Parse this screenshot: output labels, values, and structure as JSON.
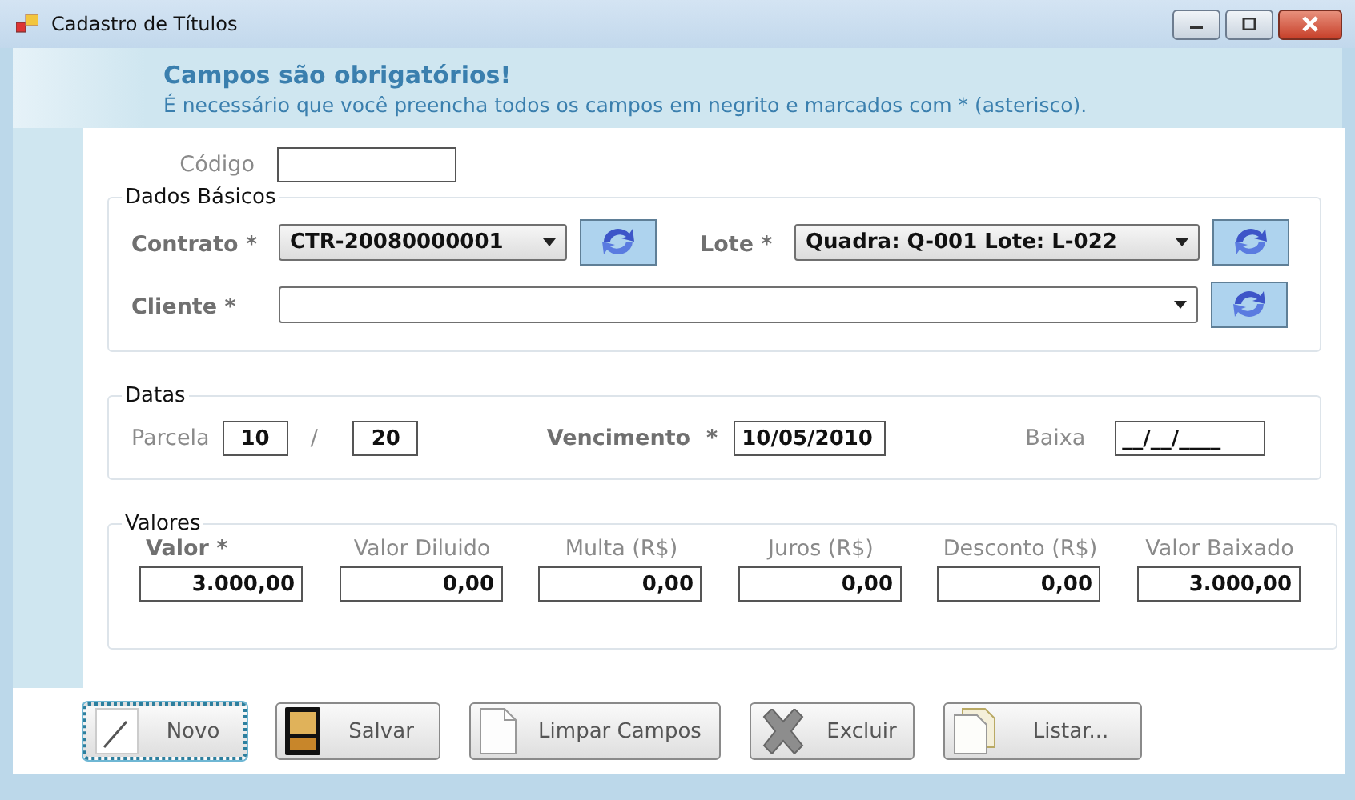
{
  "window": {
    "title": "Cadastro de Títulos"
  },
  "notice": {
    "title": "Campos são obrigatórios!",
    "text": "É necessário que você preencha todos os campos em negrito e marcados com * (asterisco)."
  },
  "codigo": {
    "label": "Código"
  },
  "dados_basicos": {
    "legend": "Dados Básicos",
    "contrato": {
      "label": "Contrato *",
      "value": "CTR-20080000001",
      "required": true
    },
    "lote": {
      "label": "Lote *",
      "value": "Quadra: Q-001 Lote: L-022",
      "required": true
    },
    "cliente": {
      "label": "Cliente *",
      "required": true
    }
  },
  "datas": {
    "legend": "Datas",
    "parcela": {
      "label": "Parcela",
      "value": "10",
      "separator": "/",
      "total": "20",
      "required": false
    },
    "vencimento": {
      "label": "Vencimento",
      "mark": "*",
      "value": "10/05/2010",
      "required": true
    },
    "baixa": {
      "label": "Baixa",
      "value": "__/__/____",
      "required": false
    }
  },
  "valores": {
    "legend": "Valores",
    "fields": [
      {
        "label": "Valor *",
        "value": "3.000,00",
        "required": true
      },
      {
        "label": "Valor Diluido",
        "value": "0,00",
        "required": false
      },
      {
        "label": "Multa (R$)",
        "value": "0,00",
        "required": false
      },
      {
        "label": "Juros (R$)",
        "value": "0,00",
        "required": false
      },
      {
        "label": "Desconto (R$)",
        "value": "0,00",
        "required": false
      },
      {
        "label": "Valor Baixado",
        "value": "3.000,00",
        "required": false
      }
    ]
  },
  "buttons": [
    {
      "label": "Novo",
      "focused": true
    },
    {
      "label": "Salvar",
      "focused": false
    },
    {
      "label": "Limpar Campos",
      "focused": false
    },
    {
      "label": "Excluir",
      "focused": false
    },
    {
      "label": "Listar...",
      "focused": false
    }
  ]
}
